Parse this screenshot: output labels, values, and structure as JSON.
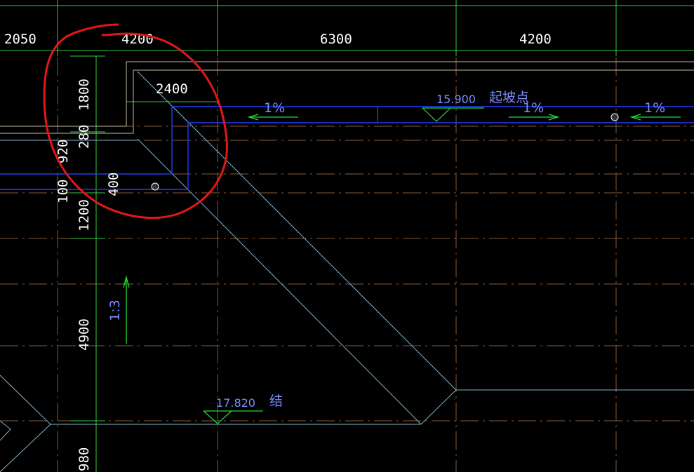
{
  "drawing": {
    "top_dimensions": [
      "2050",
      "4200",
      "6300",
      "4200",
      "2400"
    ],
    "left_dimensions": [
      "1800",
      "280",
      "920",
      "100",
      "400",
      "1200",
      "4900",
      "980"
    ],
    "slope_labels": [
      "1%",
      "1%",
      "1%"
    ],
    "slope_ratio": "1:3",
    "elevation_top": "15.900",
    "elevation_top_note": "起坡点",
    "elevation_bottom": "17.820",
    "elevation_bottom_note": "结"
  },
  "colors": {
    "background": "#000000",
    "grid_green": "#2ecc3c",
    "axis_brown": "#8a5a3a",
    "roof_cyan": "#7fb2c8",
    "gutter_blue": "#1f3cff",
    "annotation_red": "#e01818",
    "arrow_green": "#22dd33",
    "text_white": "#ffffff",
    "text_blue": "#7d8cff"
  }
}
